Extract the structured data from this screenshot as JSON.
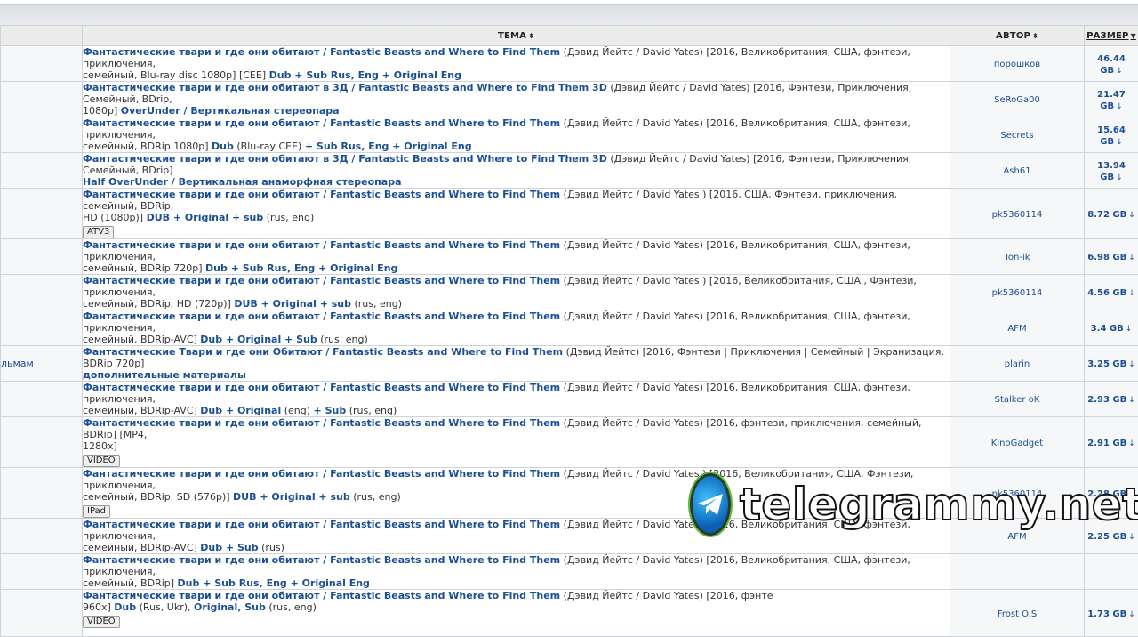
{
  "header": {
    "col_topic": "ТЕМА",
    "col_author": "АВТОР",
    "col_size": "РАЗМЕР",
    "sort_icon": "⬍",
    "sort_desc_icon": "▼"
  },
  "rows": [
    {
      "left": "",
      "title_l1": [
        [
          "Фантастические твари и где они обитают / Fantastic Beasts and Where to Find Them",
          true
        ],
        [
          " (Дэвид Йейтс / David Yates) [2016, Великобритания, США, фэнтези, приключения,",
          false
        ]
      ],
      "title_l2": [
        [
          "семейный, Blu-ray disc 1080p] [CEE] ",
          false
        ],
        [
          "Dub + Sub Rus, Eng + Original Eng",
          true
        ]
      ],
      "tag": "",
      "author": "порошков",
      "size": "46.44 GB",
      "h": 33
    },
    {
      "left": "",
      "title_l1": [
        [
          "Фантастические твари и где они обитают в 3Д / Fantastic Beasts and Where to Find Them 3D",
          true
        ],
        [
          " (Дэвид Йейтс / David Yates) [2016, Фэнтези, Приключения, Семейный, BDrip,",
          false
        ]
      ],
      "title_l2": [
        [
          "1080p] ",
          false
        ],
        [
          "OverUnder / Вертикальная стереопара",
          true
        ]
      ],
      "tag": "",
      "author": "SeRoGa00",
      "size": "21.47 GB",
      "h": 33
    },
    {
      "left": "",
      "title_l1": [
        [
          "Фантастические твари и где они обитают / Fantastic Beasts and Where to Find Them",
          true
        ],
        [
          " (Дэвид Йейтс / David Yates) [2016, Великобритания, США, фэнтези, приключения,",
          false
        ]
      ],
      "title_l2": [
        [
          "семейный, BDRip 1080p] ",
          false
        ],
        [
          "Dub",
          true
        ],
        [
          " (Blu-ray CEE) ",
          false
        ],
        [
          "+ Sub Rus, Eng + Original Eng",
          true
        ]
      ],
      "tag": "",
      "author": "Secrets",
      "size": "15.64 GB",
      "h": 33
    },
    {
      "left": "",
      "title_l1": [
        [
          "Фантастические твари и где они обитают в 3Д / Fantastic Beasts and Where to Find Them 3D",
          true
        ],
        [
          " (Дэвид Йейтс / David Yates) [2016, Фэнтези, Приключения, Семейный, BDrip]",
          false
        ]
      ],
      "title_l2": [
        [
          "Half OverUnder / Вертикальная анаморфная стереопара",
          true
        ]
      ],
      "tag": "",
      "author": "Ash61",
      "size": "13.94 GB",
      "h": 33
    },
    {
      "left": "",
      "title_l1": [
        [
          "Фантастические твари и где они обитают / Fantastic Beasts and Where to Find Them",
          true
        ],
        [
          " (Дэвид Йейтс / David Yates ) [2016, США, Фэнтези, приключения, семейный, BDRip,",
          false
        ]
      ],
      "title_l2": [
        [
          "HD (1080p)] ",
          false
        ],
        [
          "DUB + Original + sub",
          true
        ],
        [
          " (rus, eng)",
          false
        ]
      ],
      "tag": "ATV3",
      "author": "pk5360114",
      "size": "8.72 GB",
      "h": 53
    },
    {
      "left": "",
      "title_l1": [
        [
          "Фантастические твари и где они обитают / Fantastic Beasts and Where to Find Them",
          true
        ],
        [
          " (Дэвид Йейтс / David Yates) [2016, Великобритания, США, фэнтези, приключения,",
          false
        ]
      ],
      "title_l2": [
        [
          "семейный, BDRip 720p] ",
          false
        ],
        [
          "Dub + Sub Rus, Eng + Original Eng",
          true
        ]
      ],
      "tag": "",
      "author": "Ton-ik",
      "size": "6.98 GB",
      "h": 33
    },
    {
      "left": "",
      "title_l1": [
        [
          "Фантастические твари и где они обитают / Fantastic Beasts and Where to Find Them",
          true
        ],
        [
          " (Дэвид Йейтс / David Yates ) [2016, Великобритания, США , Фэнтези, приключения,",
          false
        ]
      ],
      "title_l2": [
        [
          "семейный, BDRip, HD (720p)] ",
          false
        ],
        [
          "DUB + Original + sub",
          true
        ],
        [
          " (rus, eng)",
          false
        ]
      ],
      "tag": "",
      "author": "pk5360114",
      "size": "4.56 GB",
      "h": 33
    },
    {
      "left": "",
      "title_l1": [
        [
          "Фантастические твари и где они обитают / Fantastic Beasts and Where to Find Them",
          true
        ],
        [
          " (Дэвид Йейтс / David Yates) [2016, Великобритания, США, фэнтези, приключения,",
          false
        ]
      ],
      "title_l2": [
        [
          "семейный, BDRip-AVC] ",
          false
        ],
        [
          "Dub + Original + Sub",
          true
        ],
        [
          " (rus, eng)",
          false
        ]
      ],
      "tag": "",
      "author": "AFM",
      "size": "3.4 GB",
      "h": 33
    },
    {
      "left": "льмам",
      "title_l1": [
        [
          "Фантастические Твари и где они Обитают / Fantastic Beasts and Where to Find Them",
          true
        ],
        [
          " (Дэвид Йейтс) [2016, Фэнтези | Приключения | Семейный | Экранизация, BDRip 720p]",
          false
        ]
      ],
      "title_l2": [
        [
          "дополнительные материалы",
          true
        ]
      ],
      "tag": "",
      "author": "plarin",
      "size": "3.25 GB",
      "h": 33
    },
    {
      "left": "",
      "title_l1": [
        [
          "Фантастические твари и где они обитают / Fantastic Beasts and Where to Find Them",
          true
        ],
        [
          " (Дэвид Йейтс / David Yates) [2016, Великобритания, США, фэнтези, приключения,",
          false
        ]
      ],
      "title_l2": [
        [
          "семейный, BDRip-AVC] ",
          false
        ],
        [
          "Dub + Original",
          true
        ],
        [
          " (eng) ",
          false
        ],
        [
          "+ Sub",
          true
        ],
        [
          " (rus, eng)",
          false
        ]
      ],
      "tag": "",
      "author": "Stalker oK",
      "size": "2.93 GB",
      "h": 33
    },
    {
      "left": "",
      "title_l1": [
        [
          "Фантастические твари и где они обитают / Fantastic Beasts and Where to Find Them",
          true
        ],
        [
          " (Дэвид Йейтс / David Yates) [2016, фэнтези, приключения, семейный, BDRip] [MP4,",
          false
        ]
      ],
      "title_l2": [
        [
          "1280x]",
          false
        ]
      ],
      "tag": "VIDEO",
      "author": "KinoGadget",
      "size": "2.91 GB",
      "h": 53
    },
    {
      "left": "",
      "title_l1": [
        [
          "Фантастические твари и где они обитают / Fantastic Beasts and Where to Find Them",
          true
        ],
        [
          " (Дэвид Йейтс / David Yates ) [2016, Великобритания, США, Фэнтези, приключения,",
          false
        ]
      ],
      "title_l2": [
        [
          "семейный, BDRip, SD (576p)] ",
          false
        ],
        [
          "DUB + Original + sub",
          true
        ],
        [
          " (rus, eng)",
          false
        ]
      ],
      "tag": "IPad",
      "author": "pk5360114",
      "size": "2.28 GB",
      "h": 53
    },
    {
      "left": "",
      "title_l1": [
        [
          "Фантастические твари и где они обитают / Fantastic Beasts and Where to Find Them",
          true
        ],
        [
          " (Дэвид Йейтс / David Yates) [2016, Великобритания, США, фэнтези, приключения,",
          false
        ]
      ],
      "title_l2": [
        [
          "семейный, BDRip-AVC] ",
          false
        ],
        [
          "Dub + Sub",
          true
        ],
        [
          " (rus)",
          false
        ]
      ],
      "tag": "",
      "author": "AFM",
      "size": "2.25 GB",
      "h": 33
    },
    {
      "left": "",
      "title_l1": [
        [
          "Фантастические твари и где они обитают / Fantastic Beasts and Where to Find Them",
          true
        ],
        [
          " (Дэвид Йейтс / David Yates) [2016, Великобритания, США, фэнтези, приключения,",
          false
        ]
      ],
      "title_l2": [
        [
          "семейный, BDRip] ",
          false
        ],
        [
          "Dub + Sub Rus, Eng + Original Eng",
          true
        ]
      ],
      "tag": "",
      "author": "",
      "size": "",
      "h": 33
    },
    {
      "left": "",
      "title_l1": [
        [
          "Фантастические твари и где они обитают / Fantastic Beasts and Where to Find Them",
          true
        ],
        [
          " (Дэвид Йейтс / David Yates) [2016, фэнте",
          false
        ]
      ],
      "title_l2": [
        [
          "960x] ",
          false
        ],
        [
          "Dub",
          true
        ],
        [
          " (Rus, Ukr), ",
          false
        ],
        [
          "Original, Sub",
          true
        ],
        [
          " (rus, eng)",
          false
        ]
      ],
      "tag": "VIDEO",
      "author": "Frost O.S",
      "size": "1.73 GB",
      "h": 53
    }
  ],
  "watermark": {
    "text": "telegrammy.net",
    "logo_icon": "paper-plane-icon"
  }
}
